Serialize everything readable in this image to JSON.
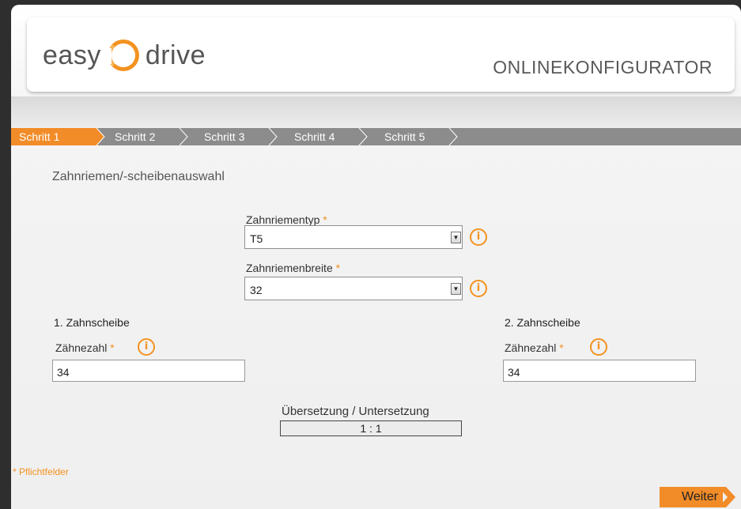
{
  "header": {
    "logo_left": "easy",
    "logo_right": "drive",
    "title": "ONLINEKONFIGURATOR"
  },
  "steps": [
    {
      "label": "Schritt 1",
      "active": true
    },
    {
      "label": "Schritt 2",
      "active": false
    },
    {
      "label": "Schritt 3",
      "active": false
    },
    {
      "label": "Schritt 4",
      "active": false
    },
    {
      "label": "Schritt 5",
      "active": false
    }
  ],
  "section_title": "Zahnriemen/-scheibenauswahl",
  "belt_type": {
    "label": "Zahnriementyp",
    "required_mark": "*",
    "value": "T5"
  },
  "belt_width": {
    "label": "Zahnriemenbreite",
    "required_mark": "*",
    "value": "32"
  },
  "pulley1": {
    "heading": "1. Zahnscheibe",
    "label": "Zähnezahl",
    "required_mark": "*",
    "value": "34"
  },
  "pulley2": {
    "heading": "2. Zahnscheibe",
    "label": "Zähnezahl",
    "required_mark": "*",
    "value": "34"
  },
  "ratio": {
    "label": "Übersetzung / Untersetzung",
    "value": "1 : 1"
  },
  "required_note": "* Pflichtfelder",
  "next_button": {
    "label": "Weiter"
  },
  "info_glyph": "i",
  "colors": {
    "accent": "#f39220",
    "step_bar": "#8c8c8c",
    "active_step": "#f28c28"
  }
}
